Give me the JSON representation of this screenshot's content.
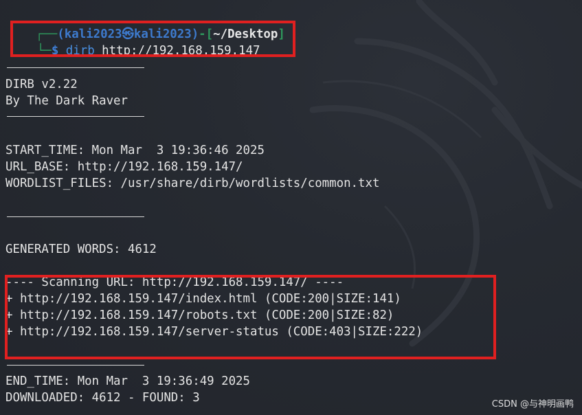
{
  "terminal": {
    "prompt": {
      "user_host": "(kali2023㉿kali2023)",
      "path": "~/Desktop"
    },
    "command": {
      "name": "dirb",
      "argument": "http://192.168.159.147"
    },
    "banner": {
      "version": "DIRB v2.22",
      "author": "By The Dark Raver"
    },
    "info": {
      "start_time": "START_TIME: Mon Mar  3 19:36:46 2025",
      "url_base": "URL_BASE: http://192.168.159.147/",
      "wordlist": "WORDLIST_FILES: /usr/share/dirb/wordlists/common.txt"
    },
    "generated_words": "GENERATED WORDS: 4612",
    "scan": {
      "header": "---- Scanning URL: http://192.168.159.147/ ----",
      "results": [
        "+ http://192.168.159.147/index.html (CODE:200|SIZE:141)",
        "+ http://192.168.159.147/robots.txt (CODE:200|SIZE:82)",
        "+ http://192.168.159.147/server-status (CODE:403|SIZE:222)"
      ]
    },
    "end_time": "END_TIME: Mon Mar  3 19:36:49 2025",
    "downloaded": "DOWNLOADED: 4612 - FOUND: 3"
  },
  "watermark": "CSDN @与神明画鸭",
  "colors": {
    "background": "#23262e",
    "text": "#e4e4e4",
    "prompt_blue": "#3f7fd6",
    "prompt_green": "#2f9e5f",
    "highlight_red": "#e02020"
  }
}
